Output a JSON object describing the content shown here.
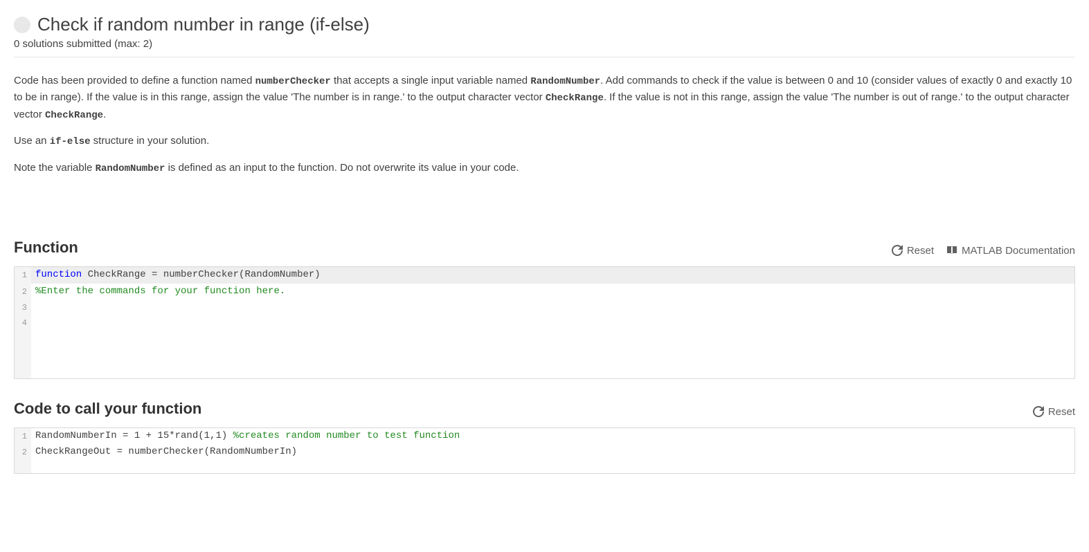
{
  "header": {
    "title": "Check if random number in range (if-else)",
    "subtitle": "0 solutions submitted (max: 2)"
  },
  "description": {
    "p1a": "Code has been provided to define a function named ",
    "p1b": "numberChecker",
    "p1c": " that accepts a single input variable named ",
    "p1d": "RandomNumber",
    "p1e": ".  Add commands to check if the value is between 0 and 10 (consider values of exactly 0 and exactly 10 to be in range). If the value is in this range, assign the value 'The number is in range.' to the output character vector ",
    "p1f": "CheckRange",
    "p1g": ". If the value is not in this range, assign the value 'The number is out of range.' to the output character vector ",
    "p1h": "CheckRange",
    "p1i": ".",
    "p2a": "Use an ",
    "p2b": "if-else",
    "p2c": " structure in your solution.",
    "p3a": "Note the variable ",
    "p3b": "RandomNumber",
    "p3c": " is defined as an input to the function.  Do not overwrite its value in your code."
  },
  "function_section": {
    "title": "Function",
    "reset": "Reset",
    "doc": "MATLAB Documentation"
  },
  "editor1": {
    "n1": "1",
    "n2": "2",
    "n3": "3",
    "n4": "4",
    "l1_kw": "function",
    "l1_rest": " CheckRange = numberChecker(RandomNumber)",
    "l2": "%Enter the commands for your function here.",
    "l3": "",
    "l4": ""
  },
  "call_section": {
    "title": "Code to call your function",
    "reset": "Reset"
  },
  "editor2": {
    "n1": "1",
    "n2": "2",
    "l1_plain": "RandomNumberIn = 1 + 15*rand(1,1) ",
    "l1_cm": "%creates random number to test function",
    "l2": "CheckRangeOut = numberChecker(RandomNumberIn)"
  }
}
